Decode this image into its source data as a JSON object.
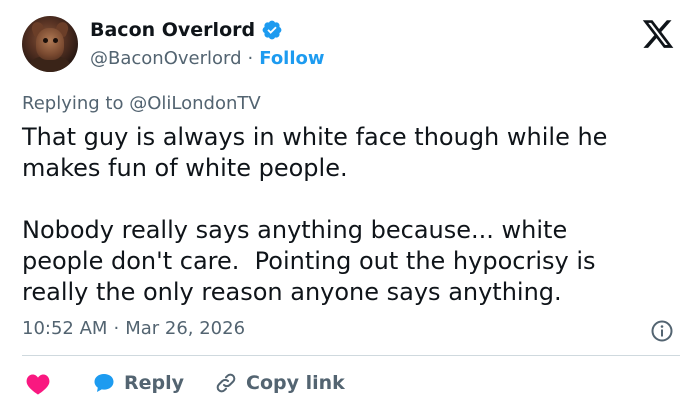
{
  "author": {
    "display_name": "Bacon Overlord",
    "handle": "@BaconOverlord",
    "separator": "·",
    "follow_label": "Follow",
    "verified": true
  },
  "tweet": {
    "replying_prefix": "Replying to",
    "replying_handle": "@OliLondonTV",
    "text": "That guy is always in white face though while he\nmakes fun of white people.\n\nNobody really says anything because... white\npeople don't care.  Pointing out the hypocrisy is\nreally the only reason anyone says anything.",
    "time": "10:52 AM",
    "time_separator": "·",
    "date": "Mar 26, 2026"
  },
  "actions": {
    "reply_label": "Reply",
    "copy_link_label": "Copy link"
  },
  "icons": {
    "platform_logo": "x-logo-icon",
    "verified": "verified-badge-icon",
    "info": "info-icon",
    "like": "heart-icon",
    "reply": "speech-bubble-icon",
    "copy": "link-icon"
  },
  "colors": {
    "accent": "#1d9bf0",
    "heart": "#f91880",
    "text": "#0f1419",
    "muted": "#536471",
    "divider": "#cfd9de"
  }
}
